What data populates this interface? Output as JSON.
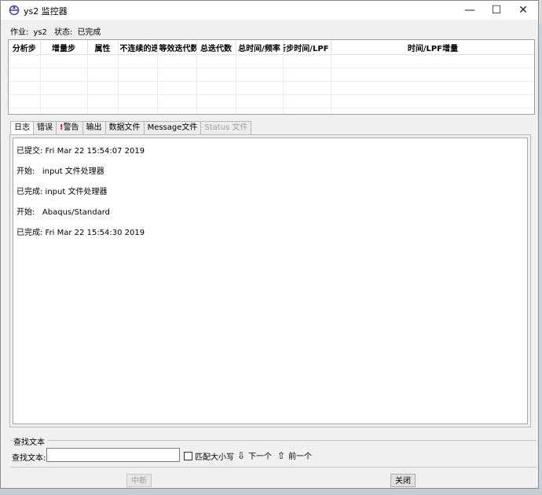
{
  "window": {
    "title": "ys2 监控器",
    "controls": {
      "minimize": "—",
      "maximize": "☐",
      "close": "✕"
    }
  },
  "job": {
    "job_label": "作业:",
    "job_name": "ys2",
    "status_label": "状态:",
    "status_value": "已完成"
  },
  "grid": {
    "columns": [
      "分析步",
      "增量步",
      "属性",
      "不连续的迭",
      "等效迭代数",
      "总迭代数",
      "总时间/频率",
      "分析步时间/LPF",
      "时间/LPF增量"
    ],
    "rows": 5
  },
  "tabs": [
    {
      "label": "日志",
      "active": true,
      "disabled": false
    },
    {
      "label": "错误",
      "active": false,
      "disabled": false
    },
    {
      "label": "警告",
      "active": false,
      "disabled": false,
      "warning": "!"
    },
    {
      "label": "输出",
      "active": false,
      "disabled": false
    },
    {
      "label": "数据文件",
      "active": false,
      "disabled": false
    },
    {
      "label": "Message文件",
      "active": false,
      "disabled": false
    },
    {
      "label": "Status 文件",
      "active": false,
      "disabled": true
    }
  ],
  "log": [
    "已提交: Fri Mar 22 15:54:07 2019",
    "开始:   input 文件处理器",
    "已完成: input 文件处理器",
    "开始:   Abaqus/Standard",
    "已完成: Fri Mar 22 15:54:30 2019"
  ],
  "find": {
    "group_label": "查找文本",
    "label": "查找文本:",
    "value": "",
    "match_case_label": "匹配大小写",
    "next_label": "下一个",
    "prev_label": "前一个"
  },
  "buttons": {
    "kill_label": "中断",
    "close_label": "关闭"
  },
  "colors": {
    "warning": "#d00000",
    "app_icon": "#4a4aa8"
  }
}
